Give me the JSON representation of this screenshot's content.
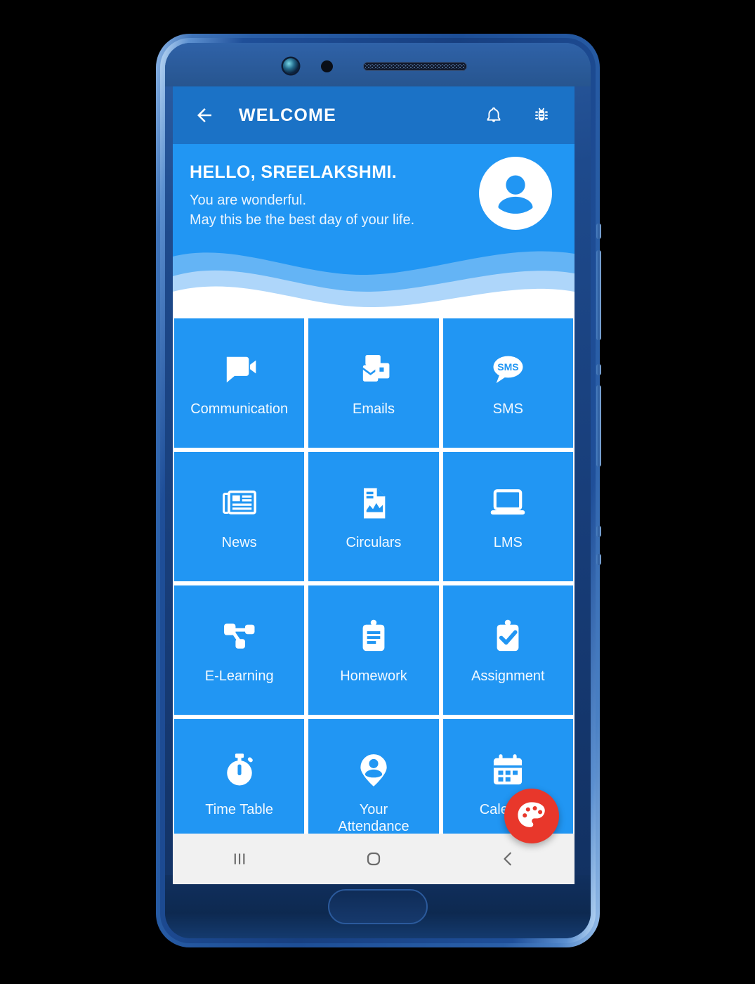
{
  "app": {
    "bar": {
      "back_icon": "back-arrow-icon",
      "title": "WELCOME",
      "notification_icon": "bell-icon",
      "bug_icon": "bug-icon"
    },
    "hero": {
      "greeting": "HELLO, SREELAKSHMI.",
      "line1": "You are wonderful.",
      "line2": "May this be the best day of your life.",
      "avatar_icon": "person-avatar-icon"
    },
    "tiles": [
      {
        "label": "Communication",
        "icon": "video-chat-bubble-icon"
      },
      {
        "label": "Emails",
        "icon": "envelope-cards-icon"
      },
      {
        "label": "SMS",
        "icon": "sms-speech-bubble-icon",
        "icon_text": "SMS"
      },
      {
        "label": "News",
        "icon": "newspaper-icon"
      },
      {
        "label": "Circulars",
        "icon": "document-chart-icon"
      },
      {
        "label": "LMS",
        "icon": "laptop-icon"
      },
      {
        "label": "E-Learning",
        "icon": "network-nodes-icon"
      },
      {
        "label": "Homework",
        "icon": "clipboard-lines-icon"
      },
      {
        "label": "Assignment",
        "icon": "clipboard-check-icon"
      },
      {
        "label": "Time Table",
        "icon": "stopwatch-icon"
      },
      {
        "label": "Your\nAttendance",
        "icon": "person-pin-icon"
      },
      {
        "label": "Calendar",
        "icon": "calendar-icon"
      }
    ],
    "fab": {
      "icon": "color-palette-icon",
      "color": "#e8372b"
    },
    "nav_bar": {
      "recents_icon": "recents-icon",
      "home_icon": "home-circle-icon",
      "back_icon": "nav-back-chevron-icon"
    }
  },
  "device": {
    "camera_icon": "front-camera-icon",
    "sensor_icon": "proximity-sensor-icon",
    "speaker_icon": "earpiece-speaker-icon",
    "home_button": "physical-home-button"
  },
  "colors": {
    "app_bar": "#1b72c6",
    "tile": "#2196f3",
    "fab": "#e8372b",
    "nav_bar": "#f1f1f1"
  }
}
